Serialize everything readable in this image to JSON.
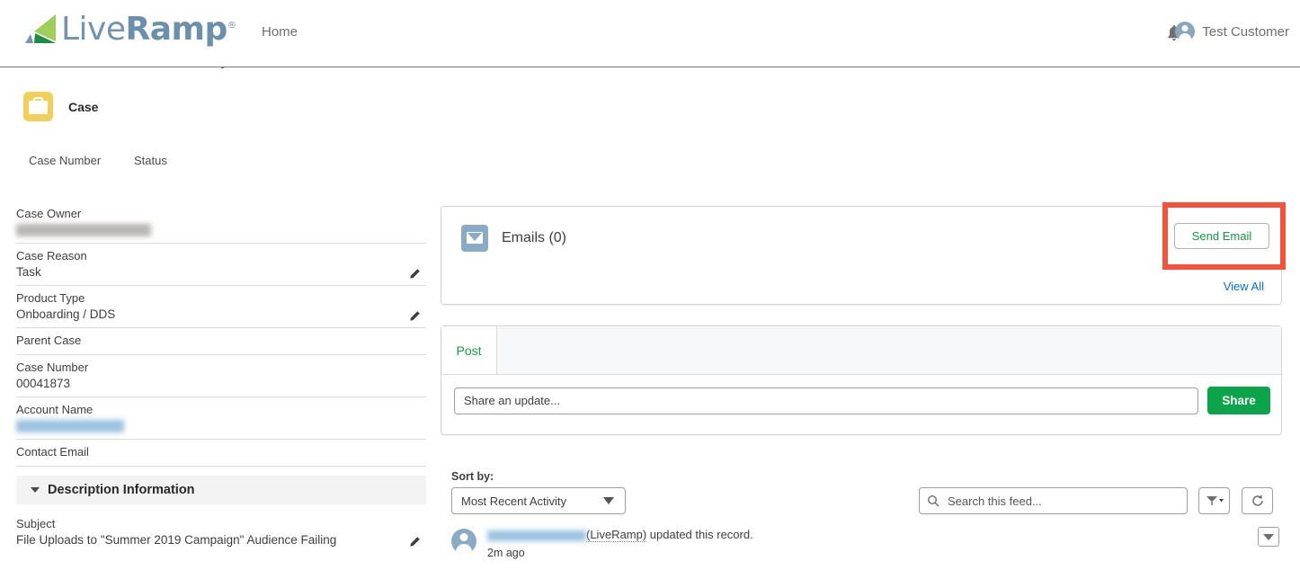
{
  "header": {
    "logo_text_light": "Live",
    "logo_text_bold": "Ramp",
    "logo_registered": "®",
    "nav_home": "Home",
    "user_name": "Test Customer",
    "bell_icon": "bell-icon",
    "user_icon": "user-avatar-icon"
  },
  "record": {
    "object_label": "Case",
    "object_icon": "briefcase-icon",
    "highlight_headers": [
      "Case Number",
      "Status"
    ],
    "fields": [
      {
        "label": "Case Owner",
        "value": "",
        "redacted": "gray",
        "editable": false
      },
      {
        "label": "Case Reason",
        "value": "Task",
        "redacted": "",
        "editable": true
      },
      {
        "label": "Product Type",
        "value": "Onboarding / DDS",
        "redacted": "",
        "editable": true
      },
      {
        "label": "Parent Case",
        "value": "",
        "redacted": "",
        "editable": false
      },
      {
        "label": "Case Number",
        "value": "00041873",
        "redacted": "",
        "editable": false
      },
      {
        "label": "Account Name",
        "value": "",
        "redacted": "blue",
        "editable": false
      },
      {
        "label": "Contact Email",
        "value": "",
        "redacted": "",
        "editable": false
      }
    ],
    "section": {
      "title": "Description Information",
      "expanded": true,
      "chevron_icon": "chevron-down-icon",
      "fields": [
        {
          "label": "Subject",
          "value": "File Uploads to \"Summer 2019 Campaign\" Audience Failing",
          "editable": true
        }
      ]
    }
  },
  "emails_panel": {
    "icon": "email-icon",
    "title": "Emails (0)",
    "send_email_label": "Send Email",
    "view_all_label": "View All",
    "highlight_color": "#f4523a",
    "send_email_text_color": "#0f9d3f",
    "view_all_color": "#0070d2"
  },
  "publisher": {
    "tabs": [
      {
        "label": "Post",
        "active": true
      }
    ],
    "share_placeholder": "Share an update...",
    "share_button_label": "Share",
    "share_button_color": "#0ba44a"
  },
  "feed": {
    "sort_label": "Sort by:",
    "sort_value": "Most Recent Activity",
    "search_placeholder": "Search this feed...",
    "search_icon": "search-icon",
    "filter_icon": "filter-icon",
    "refresh_icon": "refresh-icon",
    "items": [
      {
        "author_redacted": true,
        "org": "(LiveRamp)",
        "action": " updated this record.",
        "timestamp": "2m ago",
        "menu_icon": "chevron-down-icon"
      }
    ]
  }
}
